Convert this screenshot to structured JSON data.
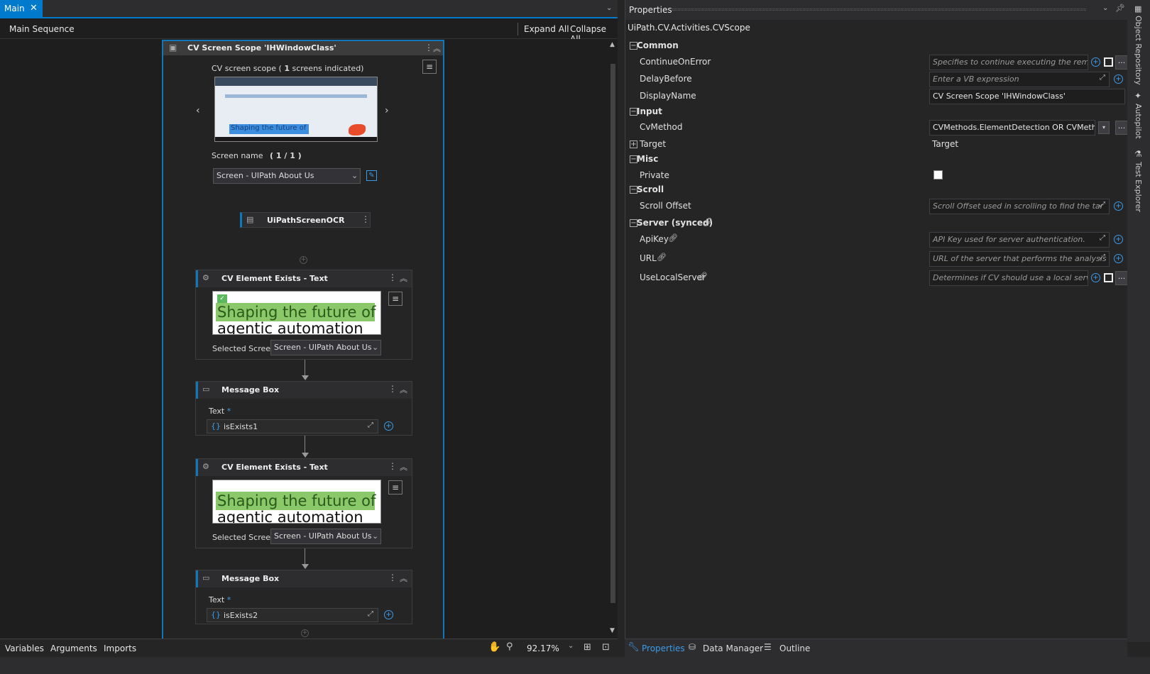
{
  "tab": {
    "title": "Main"
  },
  "designer": {
    "breadcrumb": "Main Sequence",
    "expand_all": "Expand All",
    "collapse_all": "Collapse All",
    "zoom": "92.17%",
    "bottom_tabs": [
      "Variables",
      "Arguments",
      "Imports"
    ]
  },
  "scope": {
    "title": "CV Screen Scope 'IHWindowClass'",
    "caption_pre": "CV screen scope (",
    "caption_count": "1",
    "caption_post": "screens indicated)",
    "preview_text": "Shaping the future of",
    "screen_name_label": "Screen name",
    "screen_name_index": "( 1 / 1 )",
    "screen_select": "Screen - UIPath About Us",
    "ocr_label": "UiPathScreenOCR"
  },
  "activities": [
    {
      "title": "CV Element Exists - Text",
      "ocr1": "Shaping the future of",
      "ocr2": "agentic automation",
      "selected_label": "Selected Screen",
      "selected_value": "Screen - UIPath About Us"
    },
    {
      "title": "Message Box",
      "text_label": "Text",
      "required": "*",
      "value": "isExists1"
    },
    {
      "title": "CV Element Exists - Text",
      "ocr1": "Shaping the future of",
      "ocr2": "agentic automation",
      "selected_label": "Selected Screen",
      "selected_value": "Screen - UIPath About Us"
    },
    {
      "title": "Message Box",
      "text_label": "Text",
      "required": "*",
      "value": "isExists2"
    }
  ],
  "properties": {
    "panel_title": "Properties",
    "type_name": "UiPath.CV.Activities.CVScope",
    "cat_common": "Common",
    "continue_name": "ContinueOnError",
    "continue_ph": "Specifies to continue executing the remc",
    "delay_name": "DelayBefore",
    "delay_ph": "Enter a VB expression",
    "display_name": "DisplayName",
    "display_val": "CV Screen Scope 'IHWindowClass'",
    "cat_input": "Input",
    "cvmethod_name": "CvMethod",
    "cvmethod_val": "CVMethods.ElementDetection OR CVMeth",
    "target_name": "Target",
    "target_val": "Target",
    "cat_misc": "Misc",
    "private_name": "Private",
    "cat_scroll": "Scroll",
    "scroll_name": "Scroll Offset",
    "scroll_ph": "Scroll Offset used in scrolling to find the tar",
    "cat_server": "Server (synced)",
    "apikey_name": "ApiKey",
    "apikey_ph": "API Key used for server authentication.",
    "url_name": "URL",
    "url_ph": "URL of the server that performs the analysis",
    "local_name": "UseLocalServer",
    "local_ph": "Determines if CV should use a local serv",
    "bottom_tabs": [
      "Properties",
      "Data Manager",
      "Outline"
    ]
  },
  "sidebar": {
    "items": [
      "Object Repository",
      "Autopilot",
      "Test Explorer"
    ]
  }
}
